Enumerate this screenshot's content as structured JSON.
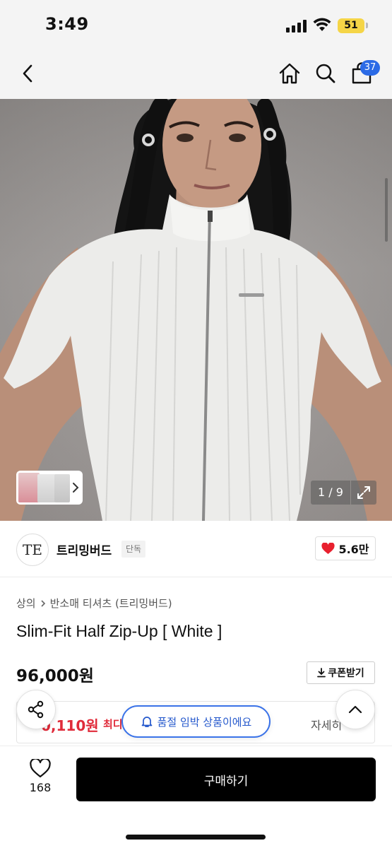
{
  "status_bar": {
    "time": "3:49",
    "battery": "51"
  },
  "nav": {
    "cart_count": "37",
    "icons": [
      "back-icon",
      "home-icon",
      "search-icon",
      "cart-icon"
    ]
  },
  "gallery": {
    "page_counter": "1 / 9"
  },
  "brand": {
    "logo_text": "TE",
    "name": "트리밍버드",
    "tag": "단독",
    "likes": "5.6만"
  },
  "product": {
    "breadcrumb": [
      "상의",
      "반소매 티셔츠 (트리밍버드)"
    ],
    "title": "Slim-Fit Half Zip-Up [ White ]",
    "price": "96,000원",
    "coupon_label": "쿠폰받기",
    "max_discount_price": "0,110원",
    "max_discount_label": "최디",
    "details_label": "자세히"
  },
  "toast": {
    "text": "품절 임박 상품이에요"
  },
  "bottom_bar": {
    "wish_count": "168",
    "buy_label": "구매하기"
  },
  "colors": {
    "accent_blue": "#2c6be6",
    "sale_red": "#e02b3a",
    "heart_red": "#e8202e"
  }
}
